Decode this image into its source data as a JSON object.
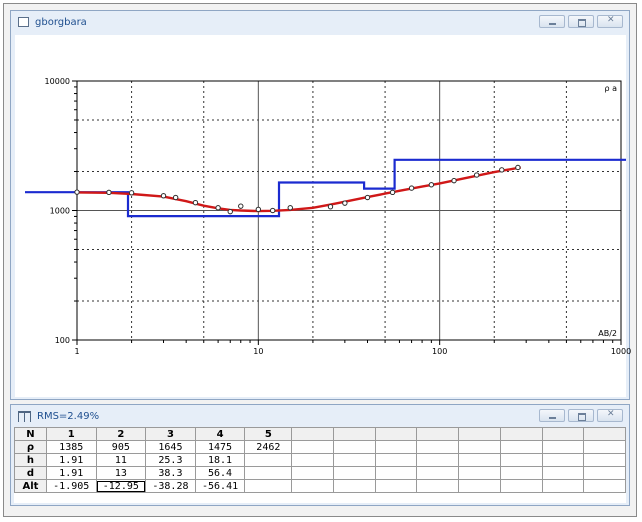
{
  "plot_window": {
    "title": "gborgbara",
    "y_axis_label": "ρ a",
    "x_axis_label": "AB/2",
    "y_ticks": [
      {
        "v": 10000,
        "label": "10000"
      },
      {
        "v": 1000,
        "label": "1000"
      },
      {
        "v": 100,
        "label": "100"
      }
    ],
    "x_ticks": [
      {
        "v": 1,
        "label": "1"
      },
      {
        "v": 10,
        "label": "10"
      },
      {
        "v": 100,
        "label": "100"
      },
      {
        "v": 1000,
        "label": "1000"
      }
    ]
  },
  "table_window": {
    "title": "RMS=2.49%",
    "header": [
      "N",
      "1",
      "2",
      "3",
      "4",
      "5",
      "",
      "",
      "",
      "",
      "",
      "",
      "",
      ""
    ],
    "rows": [
      {
        "label": "ρ",
        "cells": [
          "1385",
          "905",
          "1645",
          "1475",
          "2462",
          "",
          "",
          "",
          "",
          "",
          "",
          "",
          ""
        ]
      },
      {
        "label": "h",
        "cells": [
          "1.91",
          "11",
          "25.3",
          "18.1",
          "",
          "",
          "",
          "",
          "",
          "",
          "",
          "",
          ""
        ]
      },
      {
        "label": "d",
        "cells": [
          "1.91",
          "13",
          "38.3",
          "56.4",
          "",
          "",
          "",
          "",
          "",
          "",
          "",
          "",
          ""
        ]
      },
      {
        "label": "Alt",
        "cells": [
          "-1.905",
          "-12.95",
          "-38.28",
          "-56.41",
          "",
          "",
          "",
          "",
          "",
          "",
          "",
          "",
          ""
        ]
      }
    ]
  },
  "chart_data": {
    "type": "line",
    "x_scale": "log",
    "y_scale": "log",
    "xlim": [
      1,
      1000
    ],
    "ylim": [
      100,
      10000
    ],
    "xlabel": "AB/2",
    "ylabel": "ρ a",
    "grid": true,
    "series": [
      {
        "kind": "model_steps",
        "color": "#1b2bd0",
        "x": [
          0.3,
          1.91,
          1.91,
          13,
          13,
          38.3,
          38.3,
          56.4,
          56.4,
          1500
        ],
        "y": [
          1385,
          1385,
          905,
          905,
          1645,
          1645,
          1475,
          1475,
          2462,
          2462
        ]
      },
      {
        "kind": "fitted_curve",
        "color": "#d01818",
        "x": [
          1,
          1.5,
          2,
          3,
          4,
          5,
          6,
          7,
          8,
          10,
          12,
          15,
          20,
          25,
          30,
          40,
          50,
          60,
          80,
          100,
          150,
          200,
          280
        ],
        "y": [
          1380,
          1370,
          1340,
          1280,
          1180,
          1090,
          1040,
          1010,
          1000,
          990,
          995,
          1010,
          1050,
          1110,
          1170,
          1270,
          1350,
          1420,
          1530,
          1620,
          1820,
          1980,
          2150
        ]
      },
      {
        "kind": "observed_points",
        "color": "#000000",
        "x": [
          1,
          1.5,
          2,
          3,
          3.5,
          4.5,
          6,
          7,
          8,
          10,
          12,
          15,
          25,
          30,
          40,
          55,
          70,
          90,
          120,
          160,
          220,
          270
        ],
        "y": [
          1385,
          1380,
          1370,
          1300,
          1260,
          1150,
          1050,
          980,
          1080,
          1020,
          1000,
          1050,
          1070,
          1140,
          1260,
          1380,
          1490,
          1580,
          1700,
          1880,
          2060,
          2150
        ]
      }
    ]
  }
}
